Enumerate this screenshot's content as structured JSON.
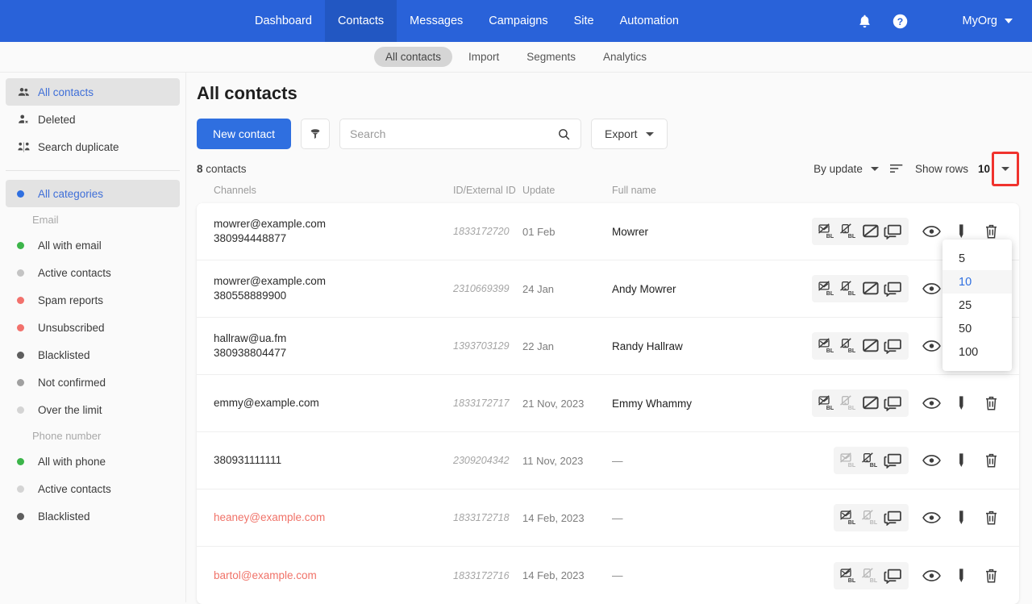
{
  "topnav": {
    "links": [
      {
        "label": "Dashboard",
        "active": false
      },
      {
        "label": "Contacts",
        "active": true
      },
      {
        "label": "Messages",
        "active": false
      },
      {
        "label": "Campaigns",
        "active": false
      },
      {
        "label": "Site",
        "active": false
      },
      {
        "label": "Automation",
        "active": false
      }
    ],
    "bell_icon": "bell-icon",
    "help_icon": "help-icon",
    "org_label": "MyOrg"
  },
  "subnav": {
    "items": [
      {
        "label": "All contacts",
        "active": true
      },
      {
        "label": "Import",
        "active": false
      },
      {
        "label": "Segments",
        "active": false
      },
      {
        "label": "Analytics",
        "active": false
      }
    ]
  },
  "sidebar": {
    "top_items": [
      {
        "label": "All contacts",
        "icon": "people-icon",
        "active": true
      },
      {
        "label": "Deleted",
        "icon": "person-remove-icon",
        "active": false
      },
      {
        "label": "Search duplicate",
        "icon": "duplicate-people-icon",
        "active": false
      }
    ],
    "all_categories": {
      "label": "All categories",
      "color": "#2f6fe0",
      "active": true
    },
    "email_group_label": "Email",
    "email_items": [
      {
        "label": "All with email",
        "color": "#3cb54a"
      },
      {
        "label": "Active contacts",
        "color": "#c4c4c4"
      },
      {
        "label": "Spam reports",
        "color": "#f2716c"
      },
      {
        "label": "Unsubscribed",
        "color": "#f2716c"
      },
      {
        "label": "Blacklisted",
        "color": "#5e5e5e"
      },
      {
        "label": "Not confirmed",
        "color": "#a0a0a0"
      },
      {
        "label": "Over the limit",
        "color": "#d4d4d4"
      }
    ],
    "phone_group_label": "Phone number",
    "phone_items": [
      {
        "label": "All with phone",
        "color": "#3cb54a"
      },
      {
        "label": "Active contacts",
        "color": "#d4d4d4"
      },
      {
        "label": "Blacklisted",
        "color": "#5e5e5e"
      }
    ]
  },
  "main": {
    "page_title": "All contacts",
    "new_contact_label": "New contact",
    "filter_icon": "funnel-icon",
    "search": {
      "value": "",
      "placeholder": "Search",
      "icon": "search-icon"
    },
    "export_label": "Export",
    "count_number": "8",
    "count_label": "contacts",
    "sort_label": "By update",
    "sort_icon": "sort-descending-icon",
    "show_rows_label": "Show rows",
    "rows_value": "10",
    "rows_dropdown_options": [
      "5",
      "10",
      "25",
      "50",
      "100"
    ],
    "rows_dropdown_selected": "10",
    "highlight_color": "#f0332e"
  },
  "table": {
    "columns": [
      "Channels",
      "ID/External ID",
      "Update",
      "Full name"
    ],
    "rows": [
      {
        "channels": [
          "mowrer@example.com",
          "380994448877"
        ],
        "email_red": false,
        "id": "1833172720",
        "update": "01 Feb",
        "name": "Mowrer",
        "group_icons": [
          {
            "name": "email-blacklist-icon",
            "dim": false
          },
          {
            "name": "phone-blacklist-icon",
            "dim": false
          },
          {
            "name": "email-unsubscribe-icon",
            "dim": false
          },
          {
            "name": "chat-messages-icon",
            "dim": false
          }
        ],
        "solo_icons": [
          {
            "name": "view-eye-icon"
          },
          {
            "name": "edit-pencil-icon"
          },
          {
            "name": "delete-trash-icon"
          }
        ]
      },
      {
        "channels": [
          "mowrer@example.com",
          "380558889900"
        ],
        "email_red": false,
        "id": "2310669399",
        "update": "24 Jan",
        "name": "Andy Mowrer",
        "group_icons": [
          {
            "name": "email-blacklist-icon",
            "dim": false
          },
          {
            "name": "phone-blacklist-icon",
            "dim": false
          },
          {
            "name": "email-unsubscribe-icon",
            "dim": false
          },
          {
            "name": "chat-messages-icon",
            "dim": false
          }
        ],
        "solo_icons": [
          {
            "name": "view-eye-icon"
          },
          {
            "name": "edit-pencil-icon"
          },
          {
            "name": "delete-trash-icon"
          }
        ]
      },
      {
        "channels": [
          "hallraw@ua.fm",
          "380938804477"
        ],
        "email_red": false,
        "id": "1393703129",
        "update": "22 Jan",
        "name": "Randy Hallraw",
        "group_icons": [
          {
            "name": "email-blacklist-icon",
            "dim": false
          },
          {
            "name": "phone-blacklist-icon",
            "dim": false
          },
          {
            "name": "email-unsubscribe-icon",
            "dim": false
          },
          {
            "name": "chat-messages-icon",
            "dim": false
          }
        ],
        "solo_icons": [
          {
            "name": "view-eye-icon"
          },
          {
            "name": "edit-pencil-icon"
          },
          {
            "name": "delete-trash-icon"
          }
        ]
      },
      {
        "channels": [
          "emmy@example.com"
        ],
        "email_red": false,
        "id": "1833172717",
        "update": "21 Nov, 2023",
        "name": "Emmy Whammy",
        "group_icons": [
          {
            "name": "email-blacklist-icon",
            "dim": false
          },
          {
            "name": "phone-blacklist-icon",
            "dim": true
          },
          {
            "name": "email-unsubscribe-icon",
            "dim": false
          },
          {
            "name": "chat-messages-icon",
            "dim": false
          }
        ],
        "solo_icons": [
          {
            "name": "view-eye-icon"
          },
          {
            "name": "edit-pencil-icon"
          },
          {
            "name": "delete-trash-icon"
          }
        ]
      },
      {
        "channels": [
          "380931111111"
        ],
        "email_red": false,
        "id": "2309204342",
        "update": "11 Nov, 2023",
        "name": "—",
        "group_icons": [
          {
            "name": "email-blacklist-icon",
            "dim": true
          },
          {
            "name": "phone-blacklist-icon",
            "dim": false
          },
          {
            "name": "chat-messages-icon",
            "dim": false
          }
        ],
        "solo_icons": [
          {
            "name": "view-eye-icon"
          },
          {
            "name": "edit-pencil-icon"
          },
          {
            "name": "delete-trash-icon"
          }
        ]
      },
      {
        "channels": [
          "heaney@example.com"
        ],
        "email_red": true,
        "id": "1833172718",
        "update": "14 Feb, 2023",
        "name": "—",
        "group_icons": [
          {
            "name": "email-blacklist-icon",
            "dim": false
          },
          {
            "name": "phone-blacklist-icon",
            "dim": true
          },
          {
            "name": "chat-messages-icon",
            "dim": false
          }
        ],
        "solo_icons": [
          {
            "name": "view-eye-icon"
          },
          {
            "name": "edit-pencil-icon"
          },
          {
            "name": "delete-trash-icon"
          }
        ]
      },
      {
        "channels": [
          "bartol@example.com"
        ],
        "email_red": true,
        "id": "1833172716",
        "update": "14 Feb, 2023",
        "name": "—",
        "group_icons": [
          {
            "name": "email-blacklist-icon",
            "dim": false
          },
          {
            "name": "phone-blacklist-icon",
            "dim": true
          },
          {
            "name": "chat-messages-icon",
            "dim": false
          }
        ],
        "solo_icons": [
          {
            "name": "view-eye-icon"
          },
          {
            "name": "edit-pencil-icon"
          },
          {
            "name": "delete-trash-icon"
          }
        ]
      }
    ]
  }
}
